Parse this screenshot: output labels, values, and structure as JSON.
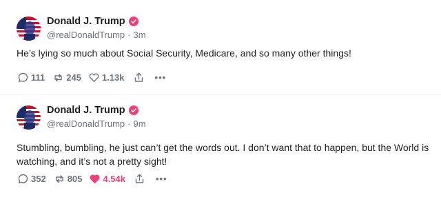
{
  "posts": [
    {
      "author": {
        "display_name": "Donald J. Trump",
        "handle": "@realDonaldTrump",
        "verified": true
      },
      "time": "3m",
      "text": "He’s lying so much about Social Security, Medicare, and so many other things!",
      "counts": {
        "replies": "111",
        "reblogs": "245",
        "likes": "1.13k"
      },
      "liked": false
    },
    {
      "author": {
        "display_name": "Donald J. Trump",
        "handle": "@realDonaldTrump",
        "verified": true
      },
      "time": "9m",
      "text": "Stumbling, bumbling, he just can’t get the words out. I don’t want that to happen, but the World is watching, and it’s not a pretty sight!",
      "counts": {
        "replies": "352",
        "reblogs": "805",
        "likes": "4.54k"
      },
      "liked": true
    }
  ],
  "colors": {
    "verified": "#ec407a",
    "liked": "#ec407a",
    "muted": "#6b7280"
  },
  "icons": {
    "reply": "reply-icon",
    "reblog": "reblog-icon",
    "like": "heart-icon",
    "share": "share-icon",
    "more": "more-icon",
    "verified": "verified-badge-icon"
  },
  "separators": {
    "dot": "·"
  },
  "more_label": "•••"
}
